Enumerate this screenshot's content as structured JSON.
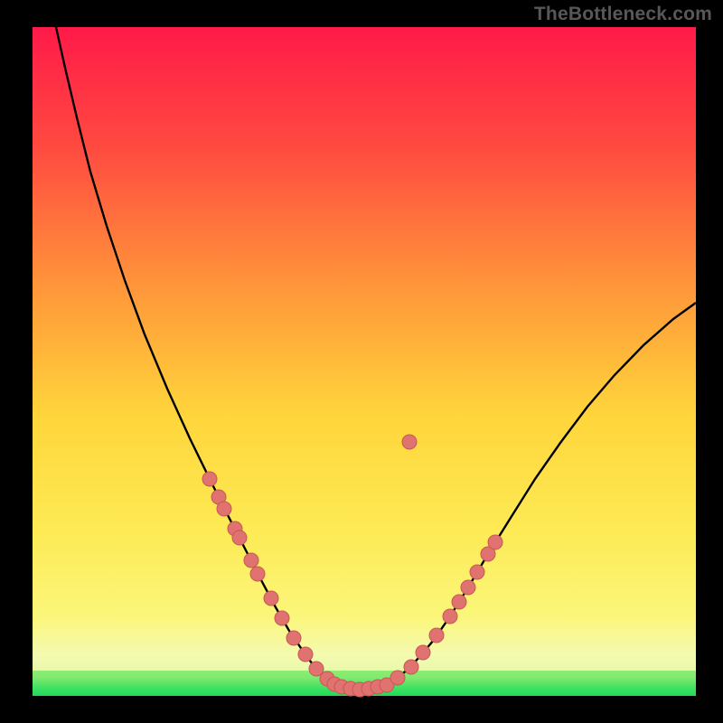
{
  "watermark": "TheBottleneck.com",
  "colors": {
    "curve": "#000000",
    "marker_fill": "#e0736f",
    "marker_stroke": "#c75854",
    "green_band_top": "#8eec74",
    "green_band_mid": "#4be364",
    "green_band_bottom": "#1ddb5a",
    "grad_top": "#ff1a49",
    "grad_upper": "#ff5a3c",
    "grad_mid": "#ffd53b",
    "grad_lower": "#fbf67a",
    "grad_pale": "#f4fab0"
  },
  "chart_data": {
    "type": "line",
    "title": "",
    "xlabel": "",
    "ylabel": "",
    "xlim": [
      36,
      770
    ],
    "ylim": [
      30,
      770
    ],
    "curve_points": [
      [
        62,
        30
      ],
      [
        72,
        75
      ],
      [
        85,
        130
      ],
      [
        100,
        190
      ],
      [
        118,
        250
      ],
      [
        138,
        310
      ],
      [
        160,
        370
      ],
      [
        185,
        430
      ],
      [
        210,
        485
      ],
      [
        232,
        530
      ],
      [
        252,
        570
      ],
      [
        270,
        605
      ],
      [
        288,
        640
      ],
      [
        305,
        672
      ],
      [
        320,
        698
      ],
      [
        335,
        720
      ],
      [
        348,
        738
      ],
      [
        360,
        750
      ],
      [
        372,
        758
      ],
      [
        385,
        762
      ],
      [
        400,
        763
      ],
      [
        415,
        762
      ],
      [
        428,
        758
      ],
      [
        440,
        750
      ],
      [
        452,
        740
      ],
      [
        465,
        726
      ],
      [
        480,
        708
      ],
      [
        498,
        682
      ],
      [
        518,
        650
      ],
      [
        540,
        613
      ],
      [
        565,
        573
      ],
      [
        592,
        530
      ],
      [
        620,
        490
      ],
      [
        650,
        450
      ],
      [
        680,
        415
      ],
      [
        712,
        382
      ],
      [
        745,
        353
      ],
      [
        770,
        335
      ]
    ],
    "markers": [
      [
        232,
        530
      ],
      [
        242,
        550
      ],
      [
        248,
        563
      ],
      [
        260,
        585
      ],
      [
        265,
        595
      ],
      [
        278,
        620
      ],
      [
        285,
        635
      ],
      [
        300,
        662
      ],
      [
        312,
        684
      ],
      [
        325,
        706
      ],
      [
        338,
        724
      ],
      [
        350,
        740
      ],
      [
        362,
        751
      ],
      [
        370,
        757
      ],
      [
        378,
        760
      ],
      [
        388,
        762
      ],
      [
        398,
        763
      ],
      [
        408,
        762
      ],
      [
        418,
        760
      ],
      [
        428,
        758
      ],
      [
        440,
        750
      ],
      [
        455,
        738
      ],
      [
        468,
        722
      ],
      [
        483,
        703
      ],
      [
        498,
        682
      ],
      [
        508,
        666
      ],
      [
        518,
        650
      ],
      [
        528,
        633
      ],
      [
        540,
        613
      ],
      [
        548,
        600
      ],
      [
        453,
        489
      ]
    ],
    "marker_radius": 8,
    "green_band": {
      "y0": 742,
      "y1": 770
    }
  }
}
